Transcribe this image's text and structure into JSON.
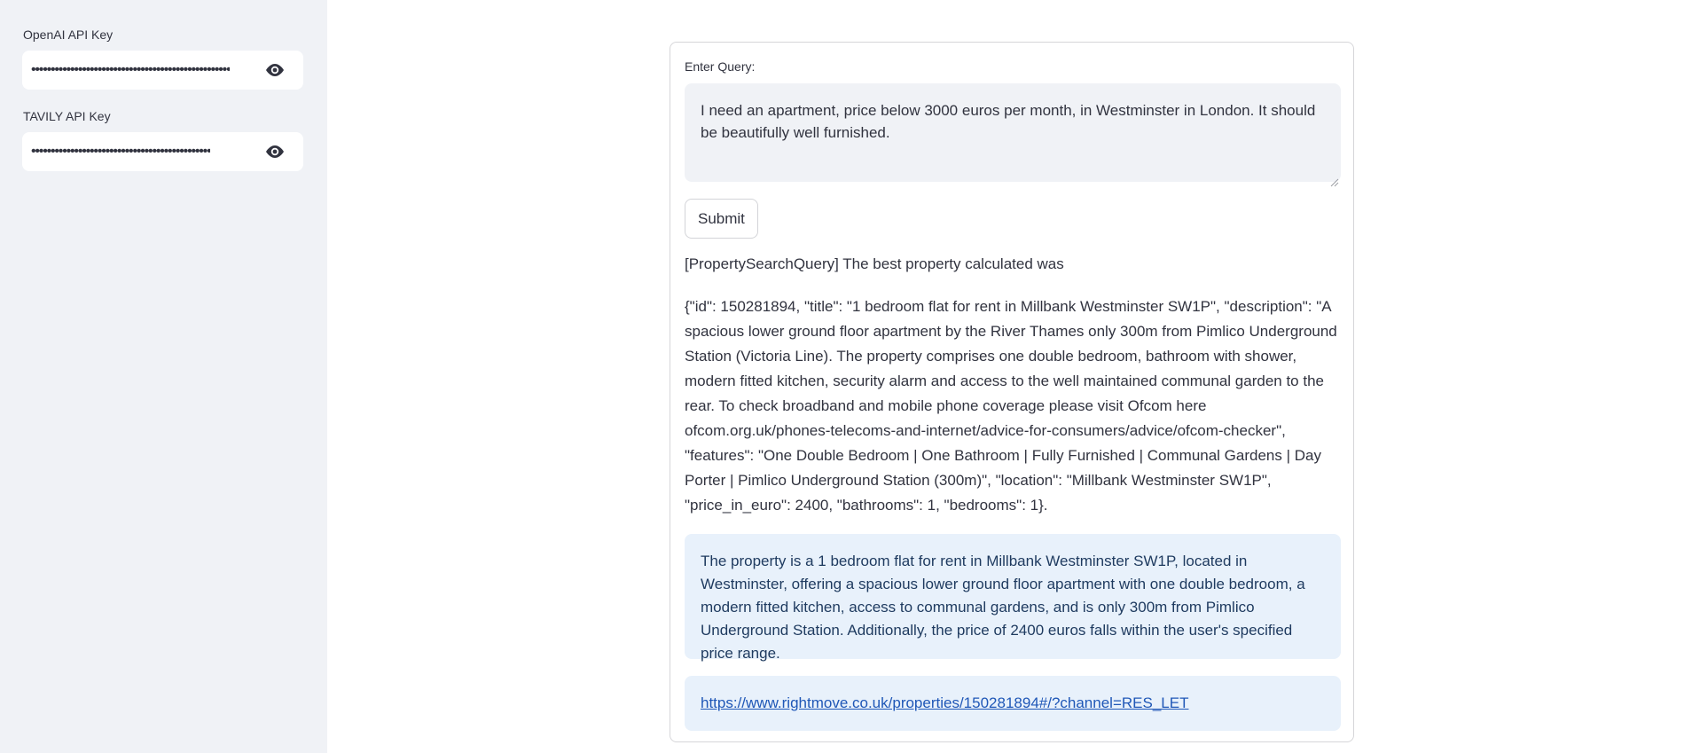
{
  "sidebar": {
    "openai": {
      "label": "OpenAI API Key",
      "masked_value": "•••••••••••••••••••••••••••••••••••••••••••••••••••"
    },
    "tavily": {
      "label": "TAVILY API Key",
      "masked_value": "••••••••••••••••••••••••••••••••••••••••••••••"
    }
  },
  "main": {
    "query_label": "Enter Query:",
    "query_value": "I need an apartment,  price below 3000 euros per month, in Westminster in London. It should be beautifully well furnished.",
    "submit_label": "Submit",
    "result_heading": "[PropertySearchQuery] The best property calculated was",
    "result_json": "{\"id\": 150281894, \"title\": \"1 bedroom flat for rent in Millbank Westminster SW1P\", \"description\": \"A spacious lower ground floor apartment by the River Thames only 300m from Pimlico Underground Station (Victoria Line). The property comprises one double bedroom, bathroom with shower, modern fitted kitchen, security alarm and access to the well maintained communal garden to the rear. To check broadband and mobile phone coverage please visit Ofcom here ofcom.org.uk/phones-telecoms-and-internet/advice-for-consumers/advice/ofcom-checker\", \"features\": \"One Double Bedroom | One Bathroom | Fully Furnished | Communal Gardens | Day Porter | Pimlico Underground Station (300m)\", \"location\": \"Millbank Westminster SW1P\", \"price_in_euro\": 2400, \"bathrooms\": 1, \"bedrooms\": 1}.",
    "summary": "The property is a 1 bedroom flat for rent in Millbank Westminster SW1P, located in Westminster, offering a spacious lower ground floor apartment with one double bedroom, a modern fitted kitchen, access to communal gardens, and is only 300m from Pimlico Underground Station. Additionally, the price of 2400 euros falls within the user's specified price range.",
    "link": "https://www.rightmove.co.uk/properties/150281894#/?channel=RES_LET"
  },
  "icons": {
    "show_password": "eye-icon"
  }
}
